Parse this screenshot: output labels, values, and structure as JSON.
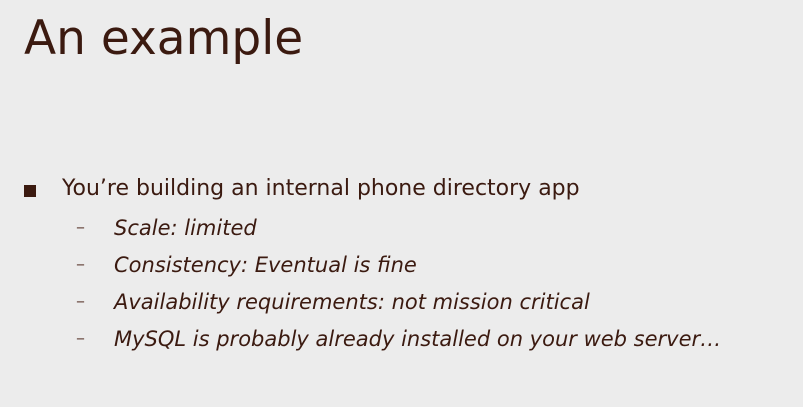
{
  "slide": {
    "title": "An example",
    "bullet": {
      "text": "You’re building an internal phone directory app",
      "sub_items": [
        {
          "dash": "–",
          "text": "Scale: limited"
        },
        {
          "dash": "–",
          "text": "Consistency: Eventual is fine"
        },
        {
          "dash": "–",
          "text": "Availability requirements: not mission critical"
        },
        {
          "dash": "–",
          "text": "MySQL is probably already installed on your web server…"
        }
      ]
    }
  },
  "colors": {
    "background": "#ececec",
    "text": "#3b1a10"
  }
}
